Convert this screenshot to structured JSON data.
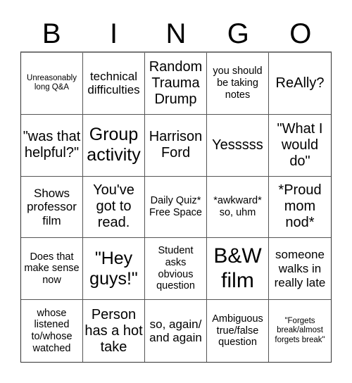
{
  "header": {
    "letters": [
      "B",
      "I",
      "N",
      "G",
      "O"
    ]
  },
  "cells": [
    "Unreasonably long Q&A",
    "technical difficulties",
    "Random Trauma Drump",
    "you should be taking notes",
    "ReAlly?",
    "\"was that helpful?\"",
    "Group activity",
    "Harrison Ford",
    "Yesssss",
    "\"What I would do\"",
    "Shows professor film",
    "You've got to read.",
    "Daily Quiz* Free Space",
    "*awkward* so, uhm",
    "*Proud mom nod*",
    "Does that make sense now",
    "\"Hey guys!\"",
    "Student asks obvious question",
    "B&W film",
    "someone walks in really late",
    "whose listened to/whose watched",
    "Person has a hot take",
    "so, again/ and again",
    "Ambiguous true/false question",
    "\"Forgets break/almost forgets break\""
  ]
}
